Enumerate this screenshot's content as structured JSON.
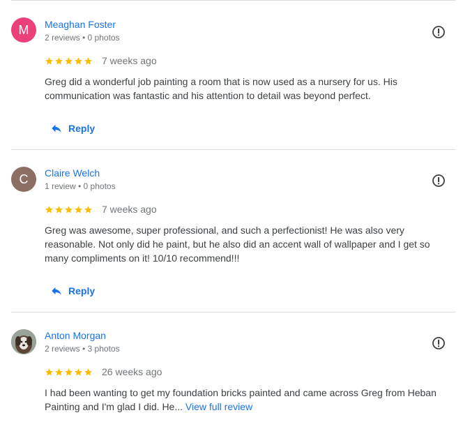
{
  "reviews": [
    {
      "avatar_letter": "M",
      "avatar_color": "#ec407a",
      "name": "Meaghan Foster",
      "meta": "2 reviews • 0 photos",
      "rating": 5,
      "when": "7 weeks ago",
      "text": "Greg did a wonderful job painting a room that is now used as a nursery for us. His communication was fantastic and his attention to detail was beyond perfect.",
      "reply_label": "Reply"
    },
    {
      "avatar_letter": "C",
      "avatar_color": "#8d6e63",
      "name": "Claire Welch",
      "meta": "1 review • 0 photos",
      "rating": 5,
      "when": "7 weeks ago",
      "text": "Greg was awesome, super professional, and such a perfectionist! He was also very reasonable. Not only did he paint, but he also did an accent wall of wallpaper and I get so many compliments on it! 10/10 recommend!!!",
      "reply_label": "Reply"
    },
    {
      "avatar_icon": "dog-photo-avatar",
      "name": "Anton Morgan",
      "meta": "2 reviews • 3 photos",
      "rating": 5,
      "when": "26 weeks ago",
      "text": "I had been wanting to get my foundation bricks painted and came across Greg from Heban Painting and I'm glad I did. He...",
      "more_link": "View full review"
    }
  ],
  "colors": {
    "star": "#fbbc04",
    "link": "#1a73e8",
    "meta": "#70757a",
    "text": "#3c4043",
    "divider": "#dadce0"
  },
  "icons": {
    "flag": "report-flag-icon",
    "reply": "reply-arrow-icon",
    "star": "star-icon"
  }
}
